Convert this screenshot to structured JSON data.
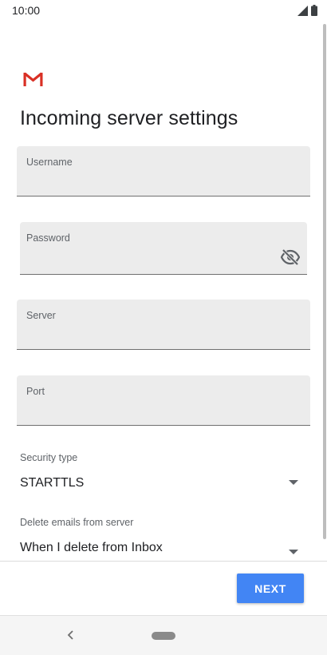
{
  "status_bar": {
    "time": "10:00",
    "icons": [
      "signal-icon",
      "battery-icon"
    ]
  },
  "app": {
    "logo": "gmail-logo-icon",
    "title": "Incoming server settings"
  },
  "form": {
    "username": {
      "label": "Username",
      "value": ""
    },
    "password": {
      "label": "Password",
      "value": "",
      "toggle_icon": "eye-off-icon"
    },
    "server": {
      "label": "Server",
      "value": ""
    },
    "port": {
      "label": "Port",
      "value": ""
    },
    "security_type": {
      "label": "Security type",
      "value": "STARTTLS"
    },
    "delete_emails": {
      "label": "Delete emails from server",
      "value": "When I delete from Inbox"
    }
  },
  "actions": {
    "next_label": "NEXT"
  },
  "nav_bar": {
    "icons": [
      "back-icon",
      "home-pill-icon"
    ]
  },
  "colors": {
    "accent": "#4285f4",
    "field_background": "#ececec",
    "gmail_red": "#d93025"
  }
}
